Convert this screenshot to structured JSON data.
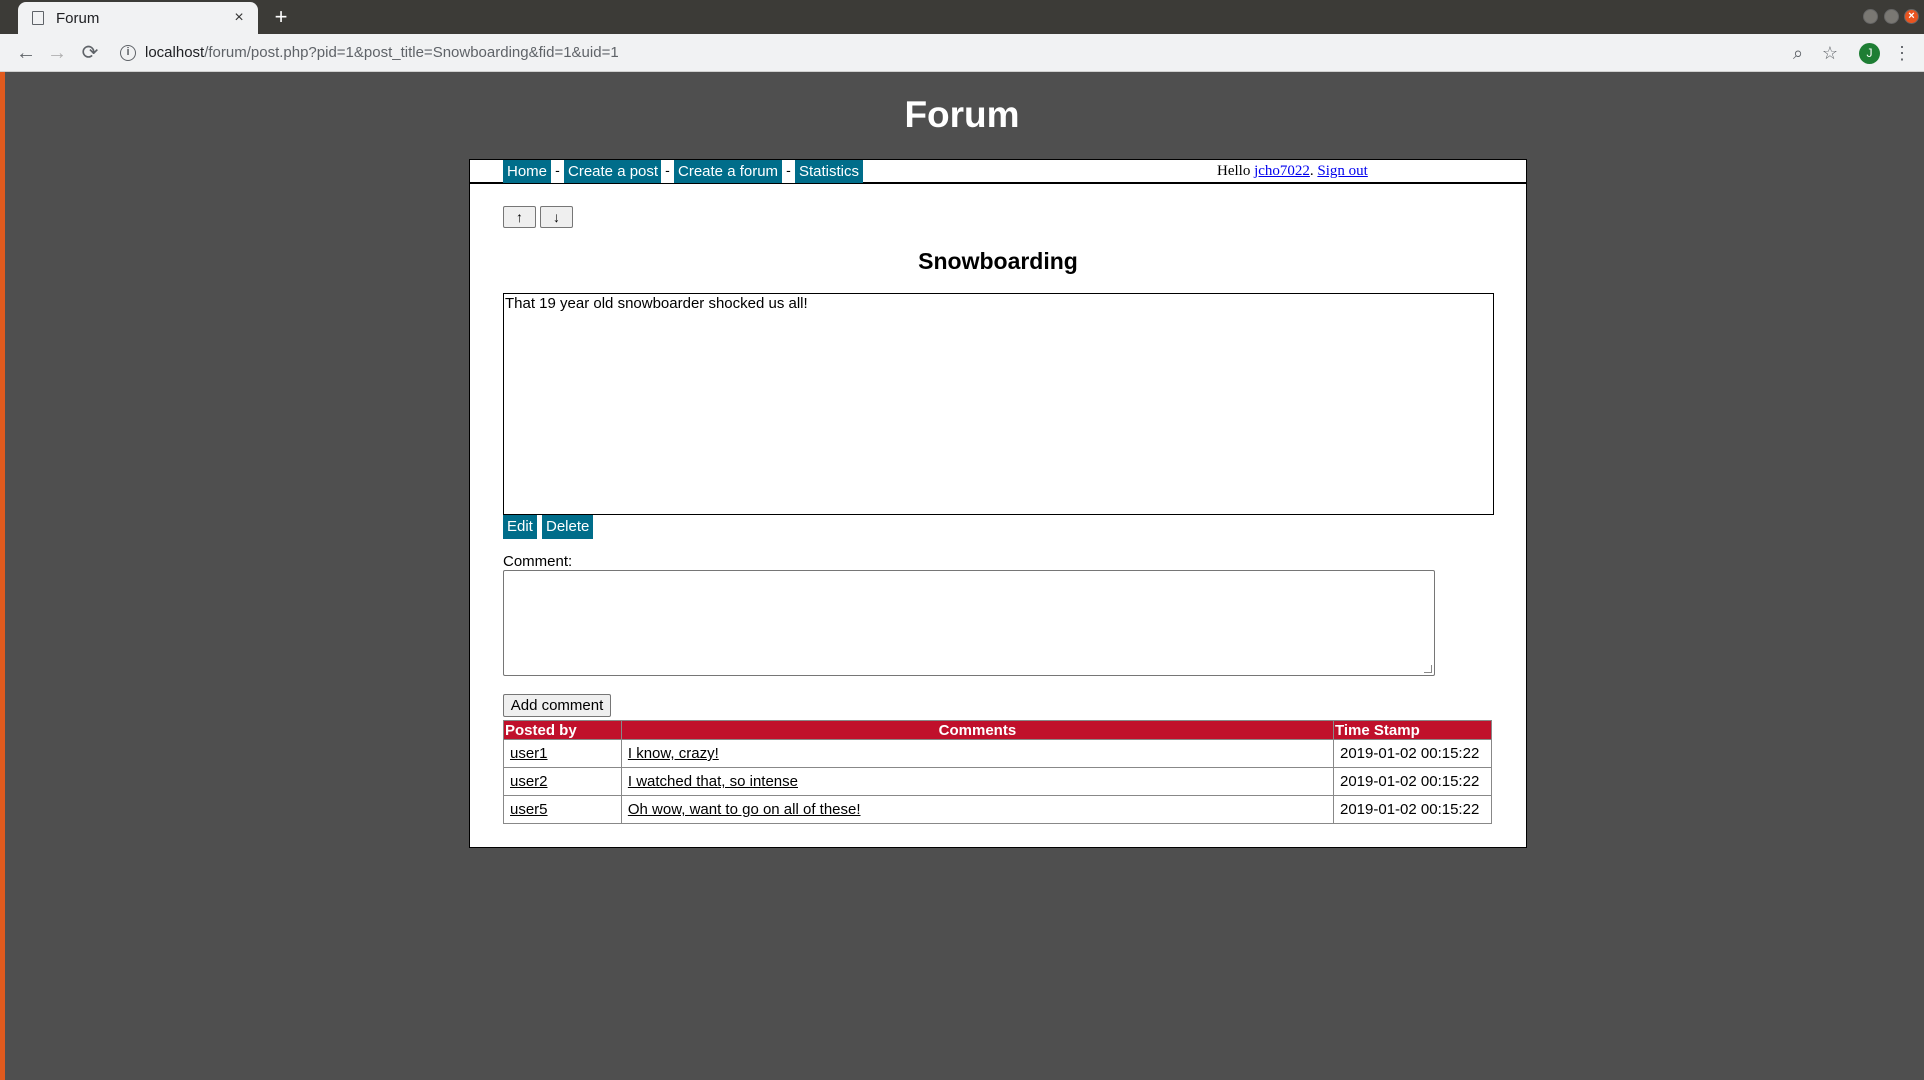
{
  "browser": {
    "tab_title": "Forum",
    "tab_close": "×",
    "new_tab": "+",
    "url_host": "localhost",
    "url_path": "/forum/post.php?pid=1&post_title=Snowboarding&fid=1&uid=1",
    "profile_initial": "J"
  },
  "site": {
    "title": "Forum"
  },
  "nav": {
    "items": [
      "Home",
      "Create a post",
      "Create a forum",
      "Statistics"
    ],
    "separator": "-",
    "greeting_prefix": "Hello ",
    "username": "jcho7022",
    "greeting_mid": ". ",
    "sign_out": "Sign out"
  },
  "post": {
    "up_label": "↑",
    "down_label": "↓",
    "title": "Snowboarding",
    "body": "That 19 year old snowboarder shocked us all!",
    "edit_label": "Edit",
    "delete_label": "Delete"
  },
  "comment_form": {
    "label": "Comment:",
    "value": "",
    "submit_label": "Add comment"
  },
  "comments_table": {
    "headers": [
      "Posted by",
      "Comments",
      "Time Stamp"
    ],
    "rows": [
      {
        "user": "user1",
        "comment": "I know, crazy!",
        "time": "2019-01-02 00:15:22"
      },
      {
        "user": "user2",
        "comment": "I watched that, so intense",
        "time": "2019-01-02 00:15:22"
      },
      {
        "user": "user5",
        "comment": "Oh wow, want to go on all of these!",
        "time": "2019-01-02 00:15:22"
      }
    ]
  },
  "colors": {
    "nav_accent": "#006d8a",
    "table_header": "#c0102b",
    "page_background": "#4f4f4f"
  }
}
